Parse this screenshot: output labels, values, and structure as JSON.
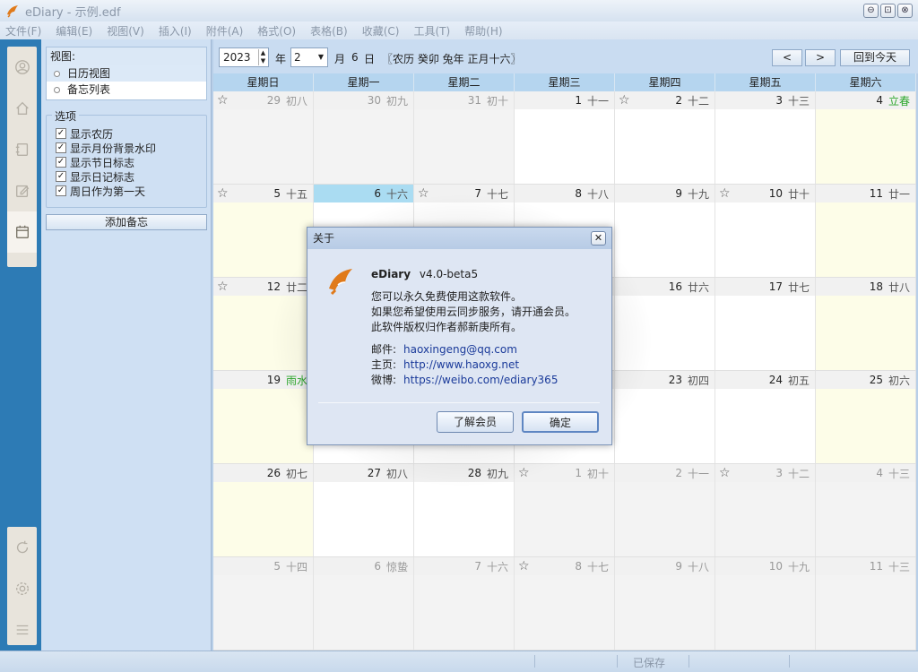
{
  "window": {
    "title": "eDiary - 示例.edf",
    "buttons": [
      "⊖",
      "⊡",
      "⊗"
    ]
  },
  "menu": [
    "文件(F)",
    "编辑(E)",
    "视图(V)",
    "插入(I)",
    "附件(A)",
    "格式(O)",
    "表格(B)",
    "收藏(C)",
    "工具(T)",
    "帮助(H)"
  ],
  "iconbar": {
    "top_icons": [
      "user-icon",
      "home-icon",
      "notebook-icon",
      "edit-icon",
      "calendar-icon"
    ],
    "bottom_icons": [
      "sync-icon",
      "settings-icon",
      "menu-icon"
    ]
  },
  "sidepanel": {
    "view_header": "视图:",
    "views": [
      "日历视图",
      "备忘列表"
    ],
    "options_title": "选项",
    "options": [
      {
        "label": "显示农历",
        "checked": true
      },
      {
        "label": "显示月份背景水印",
        "checked": true
      },
      {
        "label": "显示节日标志",
        "checked": true
      },
      {
        "label": "显示日记标志",
        "checked": true
      },
      {
        "label": "周日作为第一天",
        "checked": true
      }
    ],
    "add_memo": "添加备忘"
  },
  "toolbar": {
    "year": "2023",
    "year_label": "年",
    "month": "2",
    "month_label": "月",
    "day": "6",
    "day_label": "日",
    "lunar_info": "〖农历 癸卯 兔年 正月十六〗",
    "prev": "<",
    "next": ">",
    "today": "回到今天"
  },
  "calendar": {
    "weekdays": [
      "星期日",
      "星期一",
      "星期二",
      "星期三",
      "星期四",
      "星期五",
      "星期六"
    ],
    "weeks": [
      [
        {
          "n": "29",
          "l": "初八",
          "other": true,
          "star": true
        },
        {
          "n": "30",
          "l": "初九",
          "other": true
        },
        {
          "n": "31",
          "l": "初十",
          "other": true
        },
        {
          "n": "1",
          "l": "十一"
        },
        {
          "n": "2",
          "l": "十二",
          "star": true
        },
        {
          "n": "3",
          "l": "十三"
        },
        {
          "n": "4",
          "l": "立春",
          "fest": true
        }
      ],
      [
        {
          "n": "5",
          "l": "十五",
          "star": true
        },
        {
          "n": "6",
          "l": "十六",
          "today": true
        },
        {
          "n": "7",
          "l": "十七",
          "star": true
        },
        {
          "n": "8",
          "l": "十八"
        },
        {
          "n": "9",
          "l": "十九"
        },
        {
          "n": "10",
          "l": "廿十",
          "star": true
        },
        {
          "n": "11",
          "l": "廿一"
        }
      ],
      [
        {
          "n": "12",
          "l": "廿二",
          "star": true
        },
        {
          "n": "",
          "l": ""
        },
        {
          "n": "",
          "l": ""
        },
        {
          "n": "",
          "l": ""
        },
        {
          "n": "16",
          "l": "廿六"
        },
        {
          "n": "17",
          "l": "廿七"
        },
        {
          "n": "18",
          "l": "廿八"
        }
      ],
      [
        {
          "n": "19",
          "l": "雨水",
          "fest": true
        },
        {
          "n": "",
          "l": ""
        },
        {
          "n": "",
          "l": ""
        },
        {
          "n": "",
          "l": ""
        },
        {
          "n": "23",
          "l": "初四"
        },
        {
          "n": "24",
          "l": "初五"
        },
        {
          "n": "25",
          "l": "初六"
        }
      ],
      [
        {
          "n": "26",
          "l": "初七"
        },
        {
          "n": "27",
          "l": "初八"
        },
        {
          "n": "28",
          "l": "初九"
        },
        {
          "n": "1",
          "l": "初十",
          "other": true,
          "star": true
        },
        {
          "n": "2",
          "l": "十一",
          "other": true
        },
        {
          "n": "3",
          "l": "十二",
          "other": true,
          "star": true
        },
        {
          "n": "4",
          "l": "十三",
          "other": true
        }
      ],
      [
        {
          "n": "5",
          "l": "十四",
          "other": true
        },
        {
          "n": "6",
          "l": "惊蛰",
          "other": true,
          "fest": true
        },
        {
          "n": "7",
          "l": "十六",
          "other": true
        },
        {
          "n": "8",
          "l": "十七",
          "other": true,
          "star": true
        },
        {
          "n": "9",
          "l": "十八",
          "other": true
        },
        {
          "n": "10",
          "l": "十九",
          "other": true
        },
        {
          "n": "11",
          "l": "十三",
          "other": true
        }
      ]
    ]
  },
  "dialog": {
    "title": "关于",
    "close": "✕",
    "app_name": "eDiary",
    "version": "v4.0-beta5",
    "lines": [
      "您可以永久免费使用这款软件。",
      "如果您希望使用云同步服务，请开通会员。",
      "此软件版权归作者郝新庚所有。"
    ],
    "email_label": "邮件:",
    "email": "haoxingeng@qq.com",
    "homepage_label": "主页:",
    "homepage": "http://www.haoxg.net",
    "weibo_label": "微博:",
    "weibo": "https://weibo.com/ediary365",
    "learn_member": "了解会员",
    "ok": "确定"
  },
  "status": {
    "saved": "已保存"
  },
  "colors": {
    "accent": "#2d7bb5",
    "today_header": "#aadcf2",
    "festival": "#2ea82e",
    "logo": "#e07a1a"
  }
}
